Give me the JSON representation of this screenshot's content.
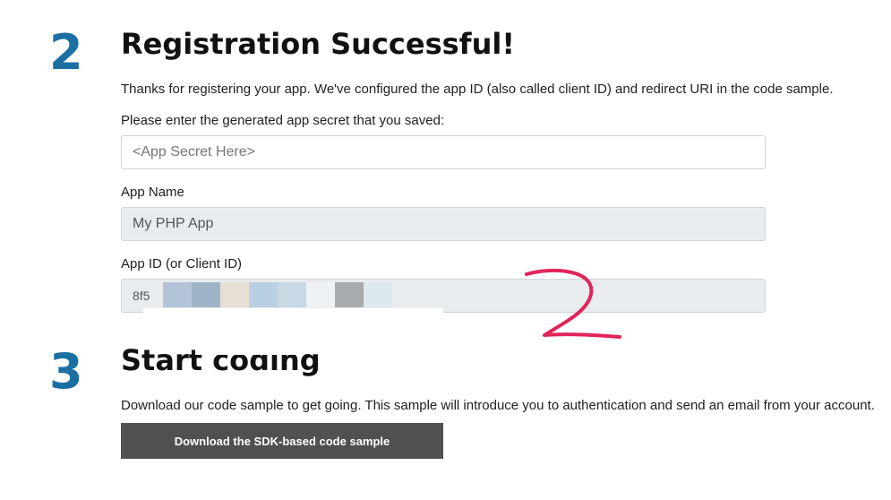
{
  "colors": {
    "accent_blue": "#1a6fa3",
    "button_bg": "#505050",
    "annotation_red": "#e0245a",
    "readonly_bg": "#e9ecef"
  },
  "step2": {
    "number": "2",
    "title": "Registration Successful!",
    "intro": "Thanks for registering your app. We've configured the app ID (also called client ID) and redirect URI in the code sample.",
    "secret_prompt": "Please enter the generated app secret that you saved:",
    "secret_placeholder": "<App Secret Here>",
    "app_name_label": "App Name",
    "app_name_value": "My PHP App",
    "app_id_label": "App ID (or Client ID)",
    "app_id_visible_prefix": "8f5"
  },
  "step3": {
    "number": "3",
    "title": "Start coding",
    "description": "Download our code sample to get going. This sample will introduce you to authentication and send an email from your account.",
    "download_button": "Download the SDK-based code sample"
  },
  "annotation": {
    "handwritten_mark": "2",
    "redaction_colors": [
      "#b3c4d9",
      "#9fb5c7",
      "#e6dfd3",
      "#b9cfe3",
      "#c8d9e6",
      "#a9acaf",
      "#dde8ef"
    ]
  }
}
